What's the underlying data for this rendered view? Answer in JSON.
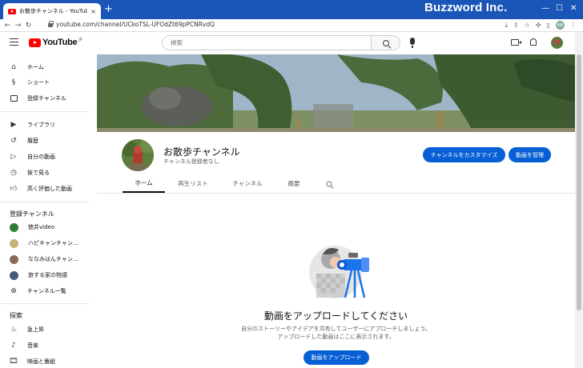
{
  "browser": {
    "tab_title": "お散歩チャンネル - YouTube",
    "tab_close": "×",
    "new_tab": "+",
    "url": "youtube.com/channel/UCkoTSL-UFOdZt69pPCNRvdQ",
    "brand_overlay": "Buzzword Inc.",
    "profile_initials": "BW"
  },
  "header": {
    "logo_text": "YouTube",
    "logo_region": "JP",
    "search_placeholder": "検索"
  },
  "sidebar": {
    "main_items": [
      {
        "label": "ホーム",
        "icon": "home-icon"
      },
      {
        "label": "ショート",
        "icon": "shorts-icon"
      },
      {
        "label": "登録チャンネル",
        "icon": "subscriptions-icon"
      }
    ],
    "library_items": [
      {
        "label": "ライブラリ",
        "icon": "library-icon"
      },
      {
        "label": "履歴",
        "icon": "history-icon"
      },
      {
        "label": "自分の動画",
        "icon": "your-videos-icon"
      },
      {
        "label": "後で見る",
        "icon": "watch-later-icon"
      },
      {
        "label": "高く評価した動画",
        "icon": "liked-videos-icon"
      }
    ],
    "subscriptions_heading": "登録チャンネル",
    "subscriptions": [
      {
        "label": "徳井video",
        "color": "#2e7d32"
      },
      {
        "label": "ハピキャンチャン...",
        "color": "#c9b27a"
      },
      {
        "label": "ななみはんチャン...",
        "color": "#8a6a5a"
      },
      {
        "label": "旅する家の物語",
        "color": "#4a5a7a"
      },
      {
        "label": "チャンネル一覧",
        "icon": "channel-list-icon"
      }
    ],
    "explore_heading": "探索",
    "explore_items": [
      {
        "label": "急上昇",
        "icon": "trending-icon"
      },
      {
        "label": "音楽",
        "icon": "music-icon"
      },
      {
        "label": "映画と番組",
        "icon": "movies-icon"
      }
    ]
  },
  "channel": {
    "name": "お散歩チャンネル",
    "subscribers": "チャンネル登録者なし",
    "customize_button": "チャンネルをカスタマイズ",
    "manage_button": "動画を管理",
    "tabs": [
      "ホーム",
      "再生リスト",
      "チャンネル",
      "概要"
    ],
    "active_tab": "ホーム"
  },
  "empty_state": {
    "title": "動画をアップロードしてください",
    "description_line1": "自分のストーリーやアイデアを共有してユーザーにアプローチしましょう。",
    "description_line2": "アップロードした動画はここに表示されます。",
    "upload_button": "動画をアップロード"
  },
  "colors": {
    "tabbar": "#1a56b8",
    "accent": "#065fd4",
    "brand_red": "#ff0000"
  }
}
